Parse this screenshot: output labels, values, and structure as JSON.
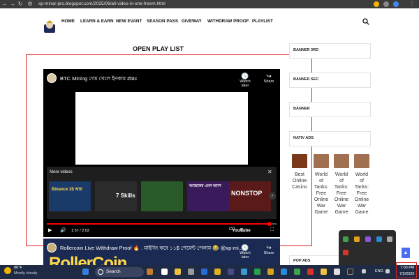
{
  "browser": {
    "url": "xp-minar-pro.blogspot.com/2025/06/all-video-in-one-freem.html"
  },
  "nav": {
    "items": [
      "HOME",
      "LEARN & EARN",
      "NEW EVANT",
      "SEASON PASS",
      "GIVEWAY",
      "WITHDRAW PROOF",
      "PLAYLIST"
    ]
  },
  "page": {
    "title": "OPEN PLAY LIST"
  },
  "video1": {
    "title": "BTC Mining গেম খেলে ইনকাম #btc",
    "watch_later": "Watch later",
    "share": "Share",
    "more_videos": "More videos",
    "thumbnails": [
      "Binance 3$ আয়",
      "7 Skills",
      "",
      "আজকের এমন অ্যাপ",
      "NONSTOP"
    ],
    "time": "1:57 / 2:02",
    "progress": 0.97,
    "youtube": "YouTube"
  },
  "video2": {
    "title": "Rollercoin Live Withdraw Proof 🔥 . মাইনিং করে ১১$ পেমেন্ট পেলাম 😂 @xp-mi...",
    "big_text": "RollerCoin",
    "watch_later": "Watch later",
    "share": "Share"
  },
  "sidebar": {
    "labels": [
      "BANNER 3RD",
      "BANNER SEC",
      "BANNER",
      "NATIV ADS",
      "POP ADS"
    ],
    "ads": [
      "Best Online Casino",
      "World of Tanks: Free Online War Game",
      "World of Tanks: Free Online War Game",
      "World of Tanks: Free Online War Game"
    ]
  },
  "taskbar": {
    "temperature": "86°F",
    "condition": "Mostly cloudy",
    "search": "Search",
    "lang": "ENG",
    "time": "7:00 PM",
    "date": "7/2/2025"
  },
  "colors": {
    "accent_red": "#e01e1e",
    "youtube_red": "#ff0000",
    "scroll_button": "#4a6cf7"
  }
}
